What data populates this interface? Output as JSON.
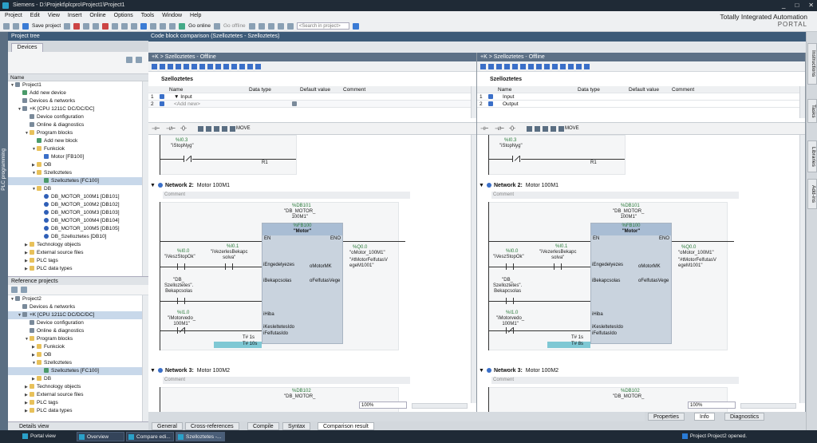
{
  "window": {
    "title": "Siemens - D:\\Projekt\\plcpro\\Project1\\Project1",
    "controls": [
      "_",
      "□",
      "✕"
    ]
  },
  "menu": [
    "Project",
    "Edit",
    "View",
    "Insert",
    "Online",
    "Options",
    "Tools",
    "Window",
    "Help"
  ],
  "toolbar": {
    "save_label": "Save project",
    "go_online": "Go online",
    "go_offline": "Go offline",
    "search_placeholder": "<Search in project>"
  },
  "brand": {
    "line1": "Totally Integrated Automation",
    "line2": "PORTAL"
  },
  "left_vertical_tab": "PLC programming",
  "project_tree": {
    "title": "Project tree",
    "tab": "Devices",
    "name_header": "Name",
    "items": [
      {
        "label": "Project1",
        "indent": 0,
        "icon": "dev",
        "arrow": "▼"
      },
      {
        "label": "Add new device",
        "indent": 1,
        "icon": "gear",
        "arrow": ""
      },
      {
        "label": "Devices & networks",
        "indent": 1,
        "icon": "dev",
        "arrow": ""
      },
      {
        "label": "+K [CPU 1211C DC/DC/DC]",
        "indent": 1,
        "icon": "dev",
        "arrow": "▼"
      },
      {
        "label": "Device configuration",
        "indent": 2,
        "icon": "dev",
        "arrow": ""
      },
      {
        "label": "Online & diagnostics",
        "indent": 2,
        "icon": "dev",
        "arrow": ""
      },
      {
        "label": "Program blocks",
        "indent": 2,
        "icon": "folder",
        "arrow": "▼"
      },
      {
        "label": "Add new block",
        "indent": 3,
        "icon": "gear",
        "arrow": ""
      },
      {
        "label": "Funkciok",
        "indent": 3,
        "icon": "folder",
        "arrow": "▼"
      },
      {
        "label": "Motor [FB100]",
        "indent": 4,
        "icon": "blk",
        "arrow": ""
      },
      {
        "label": "OB",
        "indent": 3,
        "icon": "folder",
        "arrow": "▶"
      },
      {
        "label": "Szelloztetes",
        "indent": 3,
        "icon": "folder",
        "arrow": "▼"
      },
      {
        "label": "Szelloztetes [FC100]",
        "indent": 4,
        "icon": "gear",
        "arrow": "",
        "selected": true
      },
      {
        "label": "DB",
        "indent": 3,
        "icon": "folder",
        "arrow": "▼"
      },
      {
        "label": "DB_MOTOR_100M1 [DB101]",
        "indent": 4,
        "icon": "db",
        "arrow": ""
      },
      {
        "label": "DB_MOTOR_100M2 [DB102]",
        "indent": 4,
        "icon": "db",
        "arrow": ""
      },
      {
        "label": "DB_MOTOR_100M3 [DB103]",
        "indent": 4,
        "icon": "db",
        "arrow": ""
      },
      {
        "label": "DB_MOTOR_100M4 [DB104]",
        "indent": 4,
        "icon": "db",
        "arrow": ""
      },
      {
        "label": "DB_MOTOR_100M5 [DB105]",
        "indent": 4,
        "icon": "db",
        "arrow": ""
      },
      {
        "label": "DB_Szelloztetes [DB10]",
        "indent": 4,
        "icon": "db",
        "arrow": ""
      },
      {
        "label": "Technology objects",
        "indent": 2,
        "icon": "folder",
        "arrow": "▶"
      },
      {
        "label": "External source files",
        "indent": 2,
        "icon": "folder",
        "arrow": "▶"
      },
      {
        "label": "PLC tags",
        "indent": 2,
        "icon": "folder",
        "arrow": "▶"
      },
      {
        "label": "PLC data types",
        "indent": 2,
        "icon": "folder",
        "arrow": "▶"
      }
    ]
  },
  "reference_projects": {
    "title": "Reference projects",
    "items": [
      {
        "label": "Project2",
        "indent": 0,
        "icon": "dev",
        "arrow": "▼"
      },
      {
        "label": "Devices & networks",
        "indent": 1,
        "icon": "dev",
        "arrow": ""
      },
      {
        "label": "+K [CPU 1211C DC/DC/DC]",
        "indent": 1,
        "icon": "dev",
        "arrow": "▼",
        "selected": true
      },
      {
        "label": "Device configuration",
        "indent": 2,
        "icon": "dev",
        "arrow": ""
      },
      {
        "label": "Online & diagnostics",
        "indent": 2,
        "icon": "dev",
        "arrow": ""
      },
      {
        "label": "Program blocks",
        "indent": 2,
        "icon": "folder",
        "arrow": "▼"
      },
      {
        "label": "Funkciok",
        "indent": 3,
        "icon": "folder",
        "arrow": "▶"
      },
      {
        "label": "OB",
        "indent": 3,
        "icon": "folder",
        "arrow": "▶"
      },
      {
        "label": "Szelloztetes",
        "indent": 3,
        "icon": "folder",
        "arrow": "▼"
      },
      {
        "label": "Szelloztetes [FC100]",
        "indent": 4,
        "icon": "gear",
        "arrow": "",
        "selected": true
      },
      {
        "label": "DB",
        "indent": 3,
        "icon": "folder",
        "arrow": "▶"
      },
      {
        "label": "Technology objects",
        "indent": 2,
        "icon": "folder",
        "arrow": "▶"
      },
      {
        "label": "External source files",
        "indent": 2,
        "icon": "folder",
        "arrow": "▶"
      },
      {
        "label": "PLC tags",
        "indent": 2,
        "icon": "folder",
        "arrow": "▶"
      },
      {
        "label": "PLC data types",
        "indent": 2,
        "icon": "folder",
        "arrow": "▶"
      }
    ]
  },
  "details_view": "Details view",
  "comparison": {
    "title": "Code block comparison (Szelloztetes - Szelloztetes)",
    "iface_headers": [
      "Name",
      "Data type",
      "Default value",
      "Comment"
    ],
    "left": {
      "pane_title": "+K > Szelloztetes - Offline",
      "block_name": "Szelloztetes",
      "rows": [
        {
          "num": "1",
          "name": "▼ Input"
        },
        {
          "num": "2",
          "name": "<Add new>"
        }
      ]
    },
    "right": {
      "pane_title": "+K > Szelloztetes - Offline",
      "block_name": "Szelloztetes",
      "rows": [
        {
          "num": "1",
          "name": "Input"
        },
        {
          "num": "2",
          "name": "Output"
        }
      ]
    },
    "lad_tools": [
      "⊣⊢",
      "⊣/⊢",
      "-()-",
      "MOVE"
    ],
    "network_word": "Network",
    "net1": {
      "addr": "%I0.3",
      "tag": "\"iStopNyg\"",
      "pin": "R1"
    },
    "net2": {
      "num": "2:",
      "title": "Motor 100M1",
      "comment": "Comment",
      "db_addr": "%DB101",
      "db_name": "\"DB_MOTOR_\n100M1\"",
      "fb_addr": "%FB100",
      "fb_name": "\"Motor\"",
      "en": "EN",
      "eno": "ENO",
      "c1_addr": "%I0.0",
      "c1_tag": "\"iVeszStopOk\"",
      "c2_addr": "%I0.1",
      "c2_tag": "\"iVezerlesBekapc\nsolva\"",
      "c3_tag": "\"DB_\nSzelloztetes\".\nBekapcsolas",
      "c4_addr": "%I1.0",
      "c4_tag": "\"iMotorvedo_\n100M1\"",
      "pins_in": [
        "iEngedelyezes",
        "iBekapcsolas",
        "iHiba",
        "iKesleltetesIdo",
        "iFelfutasIdo"
      ],
      "pins_out": [
        "oMotorMK",
        "oFelfutasVege"
      ],
      "out_addr": "%Q0.0",
      "out_tag": "\"oMotor_100M1\"",
      "out2_tag": "\"#tMotorFelfutasV\negeM1001\"",
      "t1": "T# 1s",
      "t2": "T# 10s",
      "t2_right": "T# 8s"
    },
    "net3": {
      "num": "3:",
      "title": "Motor 100M2",
      "comment": "Comment",
      "db_addr": "%DB102",
      "db_name": "\"DB_MOTOR_"
    },
    "zoom": "100%"
  },
  "right_tabs": [
    "Instructions",
    "Tasks",
    "Libraries",
    "Add-ins"
  ],
  "inspector_tabs": [
    "Properties",
    "Info",
    "Diagnostics"
  ],
  "bottom_tabs": [
    "General",
    "Cross-references",
    "Compile",
    "Syntax",
    "Comparison result"
  ],
  "taskbar": {
    "portal_view": "Portal view",
    "tasks": [
      "Overview",
      "Compare edi...",
      "Szelloztetes -..."
    ],
    "status": "Project Project2 opened."
  }
}
